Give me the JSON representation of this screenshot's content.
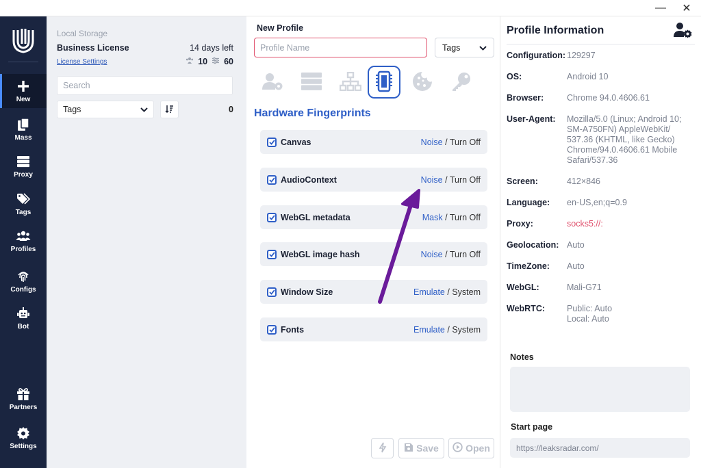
{
  "window": {
    "minimize_glyph": "—",
    "close_glyph": "✕"
  },
  "rail": {
    "items": [
      {
        "label": "New",
        "icon": "plus-icon"
      },
      {
        "label": "Mass",
        "icon": "copy-icon"
      },
      {
        "label": "Proxy",
        "icon": "server-icon"
      },
      {
        "label": "Tags",
        "icon": "tag-icon"
      },
      {
        "label": "Profiles",
        "icon": "users-icon"
      },
      {
        "label": "Configs",
        "icon": "fingerprint-icon"
      },
      {
        "label": "Bot",
        "icon": "robot-icon"
      },
      {
        "label": "Partners",
        "icon": "gift-icon"
      },
      {
        "label": "Settings",
        "icon": "gear-icon"
      }
    ]
  },
  "list": {
    "storage_title": "Local Storage",
    "license_title": "Business License",
    "days_left": "14 days left",
    "license_link": "License Settings",
    "count_a": "10",
    "count_b": "60",
    "search_placeholder": "Search",
    "tags_label": "Tags",
    "tags_count": "0"
  },
  "center": {
    "title": "New Profile",
    "profile_name_placeholder": "Profile Name",
    "tags_label": "Tags",
    "section_title": "Hardware Fingerprints",
    "tabs": [
      "user-gear-icon",
      "server-icon",
      "network-icon",
      "chip-icon",
      "cookie-icon",
      "key-icon"
    ],
    "active_tab": 3,
    "fingerprints": [
      {
        "label": "Canvas",
        "opt_a": "Noise",
        "opt_b": "Turn Off"
      },
      {
        "label": "AudioContext",
        "opt_a": "Noise",
        "opt_b": "Turn Off"
      },
      {
        "label": "WebGL metadata",
        "opt_a": "Mask",
        "opt_b": "Turn Off"
      },
      {
        "label": "WebGL image hash",
        "opt_a": "Noise",
        "opt_b": "Turn Off"
      },
      {
        "label": "Window Size",
        "opt_a": "Emulate",
        "opt_b": "System"
      },
      {
        "label": "Fonts",
        "opt_a": "Emulate",
        "opt_b": "System"
      }
    ],
    "separator": " / ",
    "save_label": "Save",
    "open_label": "Open"
  },
  "info": {
    "title": "Profile Information",
    "rows": [
      {
        "key": "Configuration:",
        "value": "129297"
      },
      {
        "key": "OS:",
        "value": "Android 10"
      },
      {
        "key": "Browser:",
        "value": "Chrome 94.0.4606.61"
      },
      {
        "key": "User-Agent:",
        "value": "Mozilla/5.0 (Linux; Android 10; SM-A750FN) AppleWebKit/ 537.36 (KHTML, like Gecko) Chrome/94.0.4606.61 Mobile Safari/537.36"
      },
      {
        "key": "Screen:",
        "value": "412×846"
      },
      {
        "key": "Language:",
        "value": "en-US,en;q=0.9"
      },
      {
        "key": "Proxy:",
        "value": "socks5://:"
      },
      {
        "key": "Geolocation:",
        "value": "Auto"
      },
      {
        "key": "TimeZone:",
        "value": "Auto"
      },
      {
        "key": "WebGL:",
        "value": "Mali-G71"
      },
      {
        "key": "WebRTC:",
        "value": "Public: Auto"
      },
      {
        "key": "",
        "value": "Local:  Auto"
      }
    ],
    "notes_label": "Notes",
    "start_page_label": "Start page",
    "start_page_placeholder": "https://leaksradar.com/"
  },
  "colors": {
    "rail_bg": "#1a2540",
    "accent": "#2f5fc7",
    "error_border": "#e0506c",
    "annotation_arrow": "#6a1b9a"
  }
}
